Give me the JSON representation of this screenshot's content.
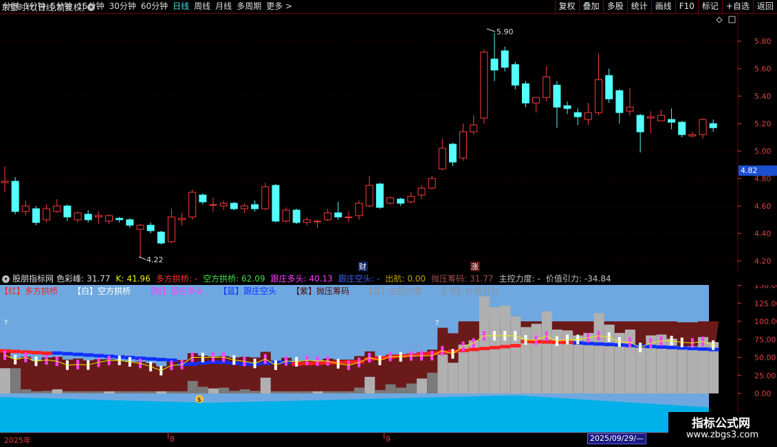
{
  "toolbar": {
    "tabs": [
      {
        "label": "分时"
      },
      {
        "label": "1分钟"
      },
      {
        "label": "5分钟"
      },
      {
        "label": "15分钟"
      },
      {
        "label": "30分钟"
      },
      {
        "label": "60分钟"
      },
      {
        "label": "日线"
      },
      {
        "label": "周线"
      },
      {
        "label": "月线"
      },
      {
        "label": "多周期"
      },
      {
        "label": "更多 >"
      }
    ],
    "active_tab": "日线",
    "actions": [
      {
        "label": "复权"
      },
      {
        "label": "叠加"
      },
      {
        "label": "多股"
      },
      {
        "label": "统计"
      },
      {
        "label": "画线"
      },
      {
        "label": "F10"
      },
      {
        "label": "标记"
      },
      {
        "label": "+自选"
      },
      {
        "label": "返回"
      }
    ]
  },
  "stock": {
    "title": "东望时代(日线,前复权)"
  },
  "price_axis": [
    "5.80",
    "5.60",
    "5.40",
    "5.20",
    "5.00",
    "4.80",
    "4.60",
    "4.40",
    "4.20"
  ],
  "price_flag": "4.82",
  "annotations": {
    "high": "5.90",
    "low": "4.22",
    "cai": "财",
    "zhang": "涨"
  },
  "candles": [
    [
      4.77,
      4.78,
      4.89,
      4.7
    ],
    [
      4.78,
      4.56,
      4.81,
      4.54
    ],
    [
      4.56,
      4.6,
      4.64,
      4.53
    ],
    [
      4.58,
      4.48,
      4.6,
      4.46
    ],
    [
      4.5,
      4.58,
      4.61,
      4.48
    ],
    [
      4.56,
      4.6,
      4.65,
      4.55
    ],
    [
      4.6,
      4.52,
      4.61,
      4.49
    ],
    [
      4.5,
      4.55,
      4.56,
      4.48
    ],
    [
      4.54,
      4.5,
      4.57,
      4.48
    ],
    [
      4.52,
      4.53,
      4.56,
      4.47
    ],
    [
      4.49,
      4.53,
      4.54,
      4.47
    ],
    [
      4.51,
      4.5,
      4.52,
      4.48
    ],
    [
      4.5,
      4.46,
      4.51,
      4.44
    ],
    [
      4.43,
      4.46,
      4.47,
      4.22
    ],
    [
      4.46,
      4.42,
      4.48,
      4.4
    ],
    [
      4.41,
      4.33,
      4.42,
      4.32
    ],
    [
      4.34,
      4.52,
      4.58,
      4.33
    ],
    [
      4.5,
      4.51,
      4.55,
      4.46
    ],
    [
      4.52,
      4.7,
      4.72,
      4.5
    ],
    [
      4.68,
      4.63,
      4.69,
      4.61
    ],
    [
      4.61,
      4.61,
      4.66,
      4.56
    ],
    [
      4.6,
      4.62,
      4.64,
      4.57
    ],
    [
      4.62,
      4.58,
      4.63,
      4.57
    ],
    [
      4.58,
      4.6,
      4.62,
      4.55
    ],
    [
      4.61,
      4.58,
      4.64,
      4.56
    ],
    [
      4.58,
      4.74,
      4.77,
      4.57
    ],
    [
      4.75,
      4.49,
      4.76,
      4.48
    ],
    [
      4.49,
      4.57,
      4.59,
      4.48
    ],
    [
      4.57,
      4.48,
      4.58,
      4.47
    ],
    [
      4.48,
      4.5,
      4.52,
      4.46
    ],
    [
      4.49,
      4.49,
      4.5,
      4.44
    ],
    [
      4.5,
      4.55,
      4.58,
      4.49
    ],
    [
      4.55,
      4.52,
      4.63,
      4.5
    ],
    [
      4.52,
      4.52,
      4.56,
      4.48
    ],
    [
      4.53,
      4.62,
      4.64,
      4.5
    ],
    [
      4.6,
      4.75,
      4.82,
      4.59
    ],
    [
      4.76,
      4.59,
      4.77,
      4.58
    ],
    [
      4.62,
      4.66,
      4.67,
      4.61
    ],
    [
      4.65,
      4.62,
      4.66,
      4.6
    ],
    [
      4.63,
      4.67,
      4.7,
      4.62
    ],
    [
      4.68,
      4.73,
      4.75,
      4.65
    ],
    [
      4.73,
      4.8,
      4.82,
      4.72
    ],
    [
      4.87,
      5.02,
      5.09,
      4.86
    ],
    [
      5.05,
      4.92,
      5.06,
      4.89
    ],
    [
      4.95,
      5.14,
      5.2,
      4.93
    ],
    [
      5.14,
      5.19,
      5.26,
      5.12
    ],
    [
      5.24,
      5.72,
      5.74,
      5.2
    ],
    [
      5.67,
      5.59,
      5.86,
      5.51
    ],
    [
      5.73,
      5.61,
      5.76,
      5.58
    ],
    [
      5.63,
      5.48,
      5.65,
      5.45
    ],
    [
      5.49,
      5.35,
      5.51,
      5.32
    ],
    [
      5.35,
      5.39,
      5.37,
      5.28
    ],
    [
      5.39,
      5.54,
      5.62,
      5.36
    ],
    [
      5.48,
      5.32,
      5.51,
      5.17
    ],
    [
      5.33,
      5.31,
      5.36,
      5.27
    ],
    [
      5.28,
      5.25,
      5.31,
      5.19
    ],
    [
      5.23,
      5.28,
      5.35,
      5.19
    ],
    [
      5.28,
      5.52,
      5.71,
      5.26
    ],
    [
      5.55,
      5.38,
      5.6,
      5.35
    ],
    [
      5.44,
      5.28,
      5.45,
      5.2
    ],
    [
      5.29,
      5.32,
      5.46,
      5.26
    ],
    [
      5.26,
      5.14,
      5.27,
      4.99
    ],
    [
      5.24,
      5.25,
      5.29,
      5.13
    ],
    [
      5.22,
      5.26,
      5.3,
      5.22
    ],
    [
      5.23,
      5.21,
      5.31,
      5.16
    ],
    [
      5.21,
      5.12,
      5.22,
      5.1
    ],
    [
      5.11,
      5.12,
      5.14,
      5.1
    ],
    [
      5.12,
      5.23,
      5.24,
      5.09
    ],
    [
      5.2,
      5.17,
      5.23,
      5.14
    ]
  ],
  "indicator": {
    "name": "股朋指标网",
    "values": [
      {
        "label": "色彩峰:",
        "value": "31.77",
        "color": "#dcdcdc"
      },
      {
        "label": "K:",
        "value": "41.96",
        "color": "#f0f000"
      },
      {
        "label": "多方拱桥:",
        "value": "-",
        "color": "#ff3030"
      },
      {
        "label": "空方拱桥:",
        "value": "62.09",
        "color": "#40e040"
      },
      {
        "label": "跟庄多头:",
        "value": "40.13",
        "color": "#ff40ff"
      },
      {
        "label": "跟庄空头:",
        "value": "-",
        "color": "#4060ff"
      },
      {
        "label": "出航:",
        "value": "0.00",
        "color": "#c0a000"
      },
      {
        "label": "抛压筹码:",
        "value": "31.77",
        "color": "#a05050"
      },
      {
        "label": "主控力度:",
        "value": "-",
        "color": "#c0c0c0"
      },
      {
        "label": "价值引力:",
        "value": "-34.84",
        "color": "#c0c0c0"
      }
    ],
    "legend": [
      {
        "tag": "【红】",
        "name": "多方拱桥",
        "color": "#ff2020"
      },
      {
        "tag": "【白】",
        "name": "空方拱桥",
        "color": "#ffffff"
      },
      {
        "tag": "【粉】",
        "name": "跟庄多头",
        "color": "#ff40ff"
      },
      {
        "tag": "【蓝】",
        "name": "跟庄空头",
        "color": "#1030ff"
      },
      {
        "tag": "【紫】",
        "name": "抛压筹码",
        "color": "#7a1a1a"
      },
      {
        "tag": "【灰】",
        "name": "主控力度",
        "color": "#909090"
      },
      {
        "tag": "【-灰】",
        "name": "价值引力",
        "color": "#909090"
      }
    ],
    "axis": [
      "150.00",
      "125.00",
      "100.00",
      "75.00",
      "50.00",
      "25.00",
      "0.00"
    ],
    "marks": {
      "q1": "?",
      "q2": "?",
      "money": "$"
    }
  },
  "bottom_axis": {
    "labels": [
      "2025年",
      "8",
      "9"
    ],
    "date_box": "2025/09/29/—"
  },
  "watermark": {
    "line1": "指标公式网",
    "line2": "www.zbgs3.com"
  },
  "colors": {
    "up": "#ff3c3c",
    "down": "#54ffff",
    "bg": "#000000",
    "sky": "#6fa8e0",
    "water": "#00b0e8",
    "grid": "#7a0000"
  }
}
